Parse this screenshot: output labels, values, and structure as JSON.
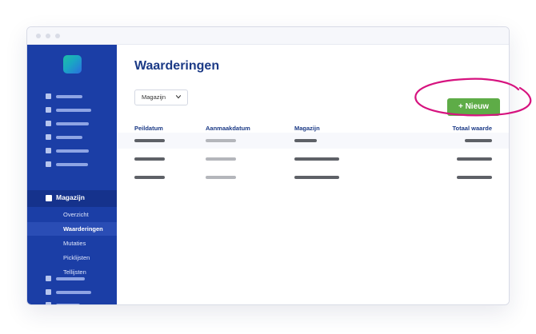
{
  "page": {
    "title": "Waarderingen"
  },
  "sidebar": {
    "active_section": "Magazijn",
    "sub_items": [
      "Overzicht",
      "Waarderingen",
      "Mutaties",
      "Picklijsten",
      "Tellijsten"
    ],
    "active_sub_item": "Waarderingen"
  },
  "filter": {
    "selected": "Magazijn"
  },
  "toolbar": {
    "new_label": "+ Nieuw"
  },
  "table": {
    "columns": [
      "Peildatum",
      "Aanmaakdatum",
      "Magazijn",
      "Totaal waarde"
    ]
  },
  "colors": {
    "sidebar": "#1b3ea6",
    "accent": "#1b3a86",
    "button": "#5eac47",
    "highlight": "#d6137f"
  }
}
